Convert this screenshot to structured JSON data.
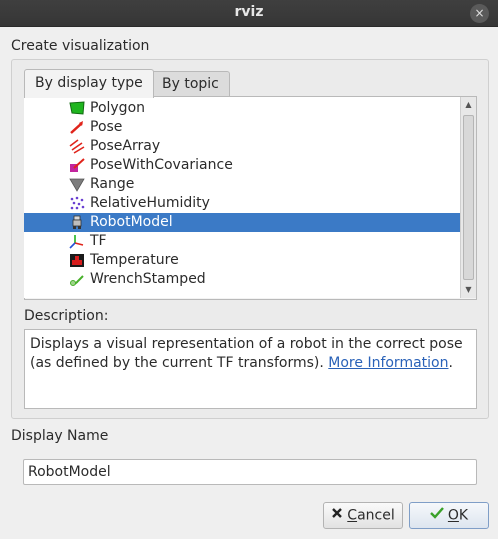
{
  "window": {
    "title": "rviz",
    "close_glyph": "×"
  },
  "create_label": "Create visualization",
  "tabs": [
    {
      "label": "By display type",
      "active": true
    },
    {
      "label": "By topic",
      "active": false
    }
  ],
  "display_types": [
    {
      "label": "Polygon",
      "icon": "polygon-icon"
    },
    {
      "label": "Pose",
      "icon": "pose-icon"
    },
    {
      "label": "PoseArray",
      "icon": "pose-array-icon"
    },
    {
      "label": "PoseWithCovariance",
      "icon": "pose-covariance-icon"
    },
    {
      "label": "Range",
      "icon": "range-icon"
    },
    {
      "label": "RelativeHumidity",
      "icon": "humidity-icon"
    },
    {
      "label": "RobotModel",
      "icon": "robot-model-icon",
      "selected": true
    },
    {
      "label": "TF",
      "icon": "tf-axes-icon"
    },
    {
      "label": "Temperature",
      "icon": "temperature-icon"
    },
    {
      "label": "WrenchStamped",
      "icon": "wrench-icon"
    }
  ],
  "description": {
    "label": "Description:",
    "text": "Displays a visual representation of a robot in the correct pose (as defined by the current TF transforms).",
    "link": "More Information",
    "trail": "."
  },
  "display_name": {
    "label": "Display Name",
    "value": "RobotModel"
  },
  "buttons": {
    "cancel_first": "C",
    "cancel_rest": "ancel",
    "ok_first": "O",
    "ok_rest": "K"
  },
  "colors": {
    "selection": "#3b7ac6",
    "link": "#2a62b8",
    "titlebar": "#3a3a3a"
  }
}
